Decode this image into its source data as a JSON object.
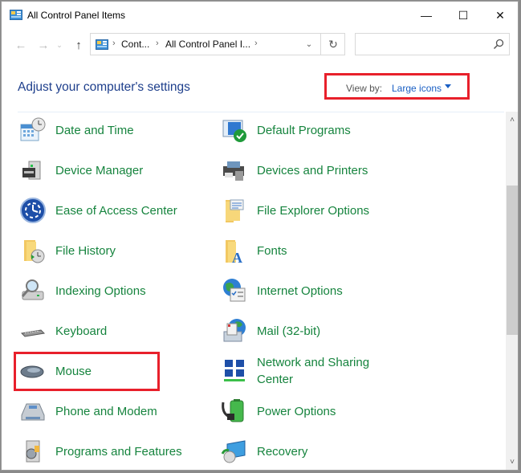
{
  "window": {
    "title": "All Control Panel Items",
    "controls": {
      "minimize": "—",
      "maximize": "☐",
      "close": "✕"
    }
  },
  "navigation": {
    "back_icon": "←",
    "forward_icon": "→",
    "recent_icon": "⌄",
    "up_icon": "↑",
    "breadcrumbs": [
      {
        "label": "Cont..."
      },
      {
        "label": "All Control Panel I..."
      }
    ],
    "separator": "›",
    "dropdown_icon": "⌄",
    "refresh_icon": "↻",
    "search": {
      "placeholder": "",
      "value": ""
    }
  },
  "header": {
    "title": "Adjust your computer's settings",
    "view_by_label": "View by:",
    "view_by_value": "Large icons"
  },
  "items": [
    {
      "label": "Date and Time",
      "icon": "calendar-clock-icon"
    },
    {
      "label": "Default Programs",
      "icon": "default-programs-icon"
    },
    {
      "label": "Device Manager",
      "icon": "device-manager-icon"
    },
    {
      "label": "Devices and Printers",
      "icon": "printer-icon"
    },
    {
      "label": "Ease of Access Center",
      "icon": "ease-of-access-icon"
    },
    {
      "label": "File Explorer Options",
      "icon": "folder-options-icon"
    },
    {
      "label": "File History",
      "icon": "file-history-icon"
    },
    {
      "label": "Fonts",
      "icon": "fonts-folder-icon"
    },
    {
      "label": "Indexing Options",
      "icon": "indexing-icon"
    },
    {
      "label": "Internet Options",
      "icon": "internet-options-icon"
    },
    {
      "label": "Keyboard",
      "icon": "keyboard-icon"
    },
    {
      "label": "Mail (32-bit)",
      "icon": "mail-icon"
    },
    {
      "label": "Mouse",
      "icon": "mouse-icon"
    },
    {
      "label": "Network and Sharing Center",
      "icon": "network-icon"
    },
    {
      "label": "Phone and Modem",
      "icon": "phone-icon"
    },
    {
      "label": "Power Options",
      "icon": "power-icon"
    },
    {
      "label": "Programs and Features",
      "icon": "programs-icon"
    },
    {
      "label": "Recovery",
      "icon": "recovery-icon"
    }
  ],
  "colors": {
    "link_green": "#16843e",
    "heading_blue": "#1e3f8c",
    "highlight_red": "#e8202b"
  },
  "scrollbar": {
    "up_icon": "˄",
    "down_icon": "˅",
    "position_fraction": 0.32
  }
}
